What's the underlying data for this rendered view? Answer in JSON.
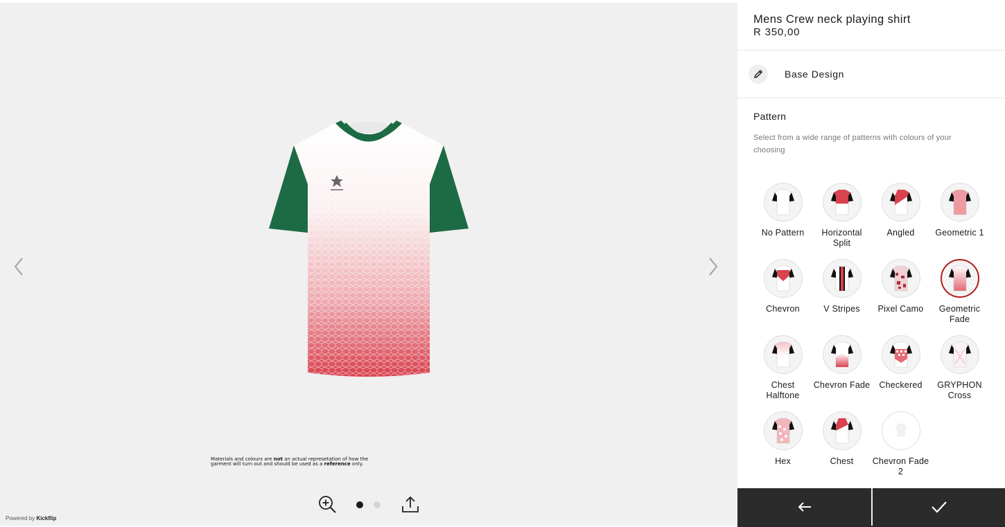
{
  "product": {
    "title": "Mens Crew neck playing shirt",
    "price": "R 350,00"
  },
  "base_design": {
    "label": "Base Design"
  },
  "pattern_section": {
    "title": "Pattern",
    "description": "Select from a wide range of patterns with colours of your choosing",
    "selected": "Geometric Fade",
    "options": [
      {
        "label": "No Pattern",
        "icon": "shirt-no-pattern-icon"
      },
      {
        "label": "Horizontal Split",
        "icon": "shirt-horizontal-split-icon"
      },
      {
        "label": "Angled",
        "icon": "shirt-angled-icon"
      },
      {
        "label": "Geometric 1",
        "icon": "shirt-geometric-1-icon"
      },
      {
        "label": "Chevron",
        "icon": "shirt-chevron-icon"
      },
      {
        "label": "V Stripes",
        "icon": "shirt-v-stripes-icon"
      },
      {
        "label": "Pixel Camo",
        "icon": "shirt-pixel-camo-icon"
      },
      {
        "label": "Geometric Fade",
        "icon": "shirt-geometric-fade-icon"
      },
      {
        "label": "Chest Halftone",
        "icon": "shirt-chest-halftone-icon"
      },
      {
        "label": "Chevron Fade",
        "icon": "shirt-chevron-fade-icon"
      },
      {
        "label": "Checkered",
        "icon": "shirt-checkered-icon"
      },
      {
        "label": "GRYPHON Cross",
        "icon": "shirt-gryphon-cross-icon"
      },
      {
        "label": "Hex",
        "icon": "shirt-hex-icon"
      },
      {
        "label": "Chest",
        "icon": "shirt-chest-icon"
      },
      {
        "label": "Chevron Fade 2",
        "icon": "shirt-chevron-fade-2-icon"
      }
    ]
  },
  "viewer": {
    "disclaimer_part1": "Materials and colours are ",
    "disclaimer_bold1": "not",
    "disclaimer_part2": " an actual represetation of how the garment will turn out and should be used as a ",
    "disclaimer_bold2": "reference",
    "disclaimer_part3": " only.",
    "powered_prefix": "Powered by ",
    "powered_brand": "Kickflip",
    "page_dots": {
      "count": 2,
      "active": 1
    }
  },
  "colors": {
    "accent_red": "#d9424f",
    "sleeve_green": "#1d6b45",
    "selected_border": "#b31b1b",
    "footer_bar": "#2b2b2b"
  },
  "icons": {
    "prev": "chevron-left-icon",
    "next": "chevron-right-icon",
    "zoom": "zoom-in-icon",
    "share": "share-upload-icon",
    "edit": "pencil-icon",
    "back": "arrow-left-icon",
    "confirm": "checkmark-icon"
  }
}
